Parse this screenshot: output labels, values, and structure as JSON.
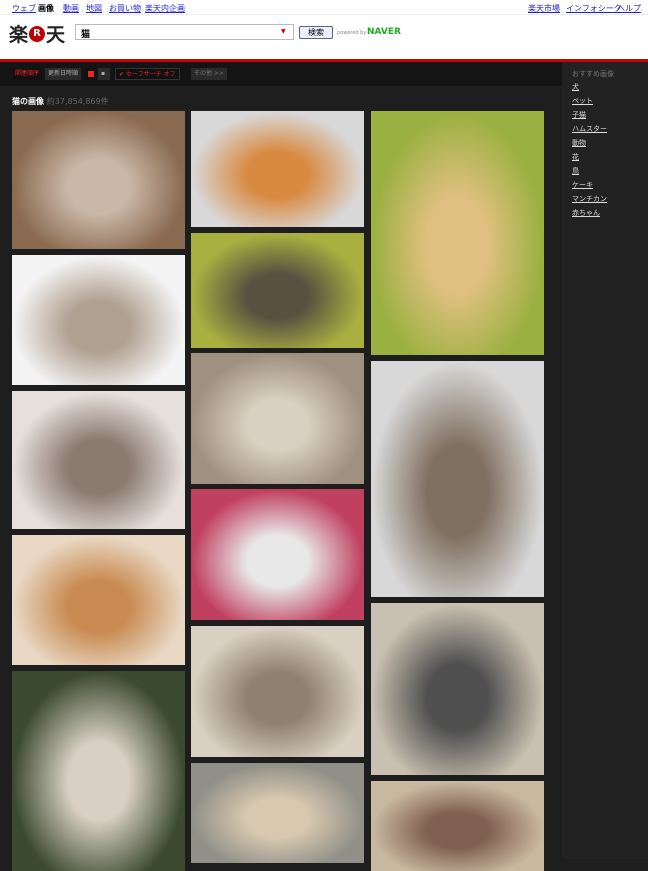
{
  "nav": {
    "left": [
      "ウェブ",
      "画像",
      "動画",
      "地図",
      "お買い物",
      "楽天内企画"
    ],
    "right": [
      "楽天市場",
      "インフォシーク",
      "ヘルプ"
    ]
  },
  "logo": {
    "pre": "楽",
    "r": "R",
    "post": "天"
  },
  "search": {
    "value": "猫",
    "button": "検索",
    "powered": "powered by",
    "brand": "NAVER",
    "brand_color": "#22aa22"
  },
  "toolbar": {
    "sort_relevance": "関連順序",
    "sort_date": "更新日時順",
    "safe": "セーフサーチ オフ",
    "other": "その他 >>"
  },
  "results": {
    "title": "猫の画像",
    "count": "約37,854,869件"
  },
  "sidebar": {
    "title": "おすすめ画像",
    "items": [
      "犬",
      "ペット",
      "子猫",
      "ハムスター",
      "動物",
      "花",
      "鳥",
      "ケーキ",
      "マンチカン",
      "赤ちゃん"
    ]
  },
  "images": [
    {
      "col": 0,
      "name": "three-kittens-in-basket",
      "colors": [
        "#8a6a50",
        "#c9b8a8"
      ]
    },
    {
      "col": 0,
      "name": "calico-kitten-white",
      "colors": [
        "#f4f4f4",
        "#b0a090"
      ]
    },
    {
      "col": 0,
      "name": "kitten-standing-arms-up",
      "colors": [
        "#e6e0dc",
        "#8a7a70"
      ]
    },
    {
      "col": 0,
      "name": "orange-kitten-with-cup",
      "colors": [
        "#e8d8c4",
        "#c88a50"
      ]
    },
    {
      "col": 0,
      "name": "calico-cat-garden",
      "colors": [
        "#3c4a30",
        "#d8d0c4"
      ]
    },
    {
      "col": 1,
      "name": "orange-white-cat-closeup",
      "colors": [
        "#d8d8d8",
        "#d88a40"
      ]
    },
    {
      "col": 1,
      "name": "tabby-cat-on-pillow",
      "colors": [
        "#a8b040",
        "#5a5040"
      ]
    },
    {
      "col": 1,
      "name": "yawning-tabby-cat",
      "colors": [
        "#a09080",
        "#d8d0c0"
      ]
    },
    {
      "col": 1,
      "name": "black-white-cat-pink-wall",
      "colors": [
        "#c04060",
        "#e8e8e8"
      ]
    },
    {
      "col": 1,
      "name": "cats-in-sink",
      "colors": [
        "#d8d0c0",
        "#908070"
      ]
    },
    {
      "col": 1,
      "name": "calico-cat-on-steps",
      "colors": [
        "#909088",
        "#d8c8b0"
      ]
    },
    {
      "col": 2,
      "name": "kitten-in-yellow-flowers",
      "colors": [
        "#9ab040",
        "#e0c080"
      ]
    },
    {
      "col": 2,
      "name": "tabby-white-cat-blue-collar",
      "colors": [
        "#d8d8d8",
        "#807060"
      ]
    },
    {
      "col": 2,
      "name": "gray-kitten-scratching-post",
      "colors": [
        "#c8c0b0",
        "#505050"
      ]
    },
    {
      "col": 2,
      "name": "tabby-kitten-closeup",
      "colors": [
        "#c8b8a0",
        "#806050"
      ]
    }
  ]
}
